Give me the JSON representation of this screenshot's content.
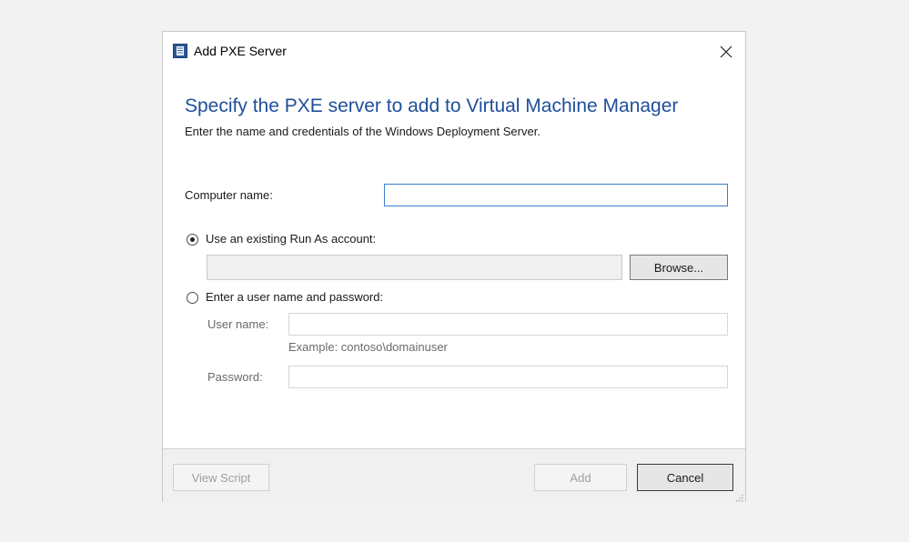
{
  "dialog": {
    "title": "Add PXE Server",
    "heading": "Specify the PXE server to add to Virtual Machine Manager",
    "subheading": "Enter the name and credentials of the Windows Deployment Server.",
    "computer_name": {
      "label": "Computer name:",
      "value": ""
    },
    "run_as": {
      "label": "Use an existing Run As account:",
      "selected": true,
      "value": "",
      "browse_label": "Browse..."
    },
    "user_pass": {
      "label": "Enter a user name and password:",
      "selected": false,
      "username_label": "User name:",
      "username_value": "",
      "example": "Example: contoso\\domainuser",
      "password_label": "Password:",
      "password_value": ""
    }
  },
  "footer": {
    "view_script_label": "View Script",
    "add_label": "Add",
    "cancel_label": "Cancel"
  },
  "icons": {
    "app": "server-icon",
    "close": "close-icon",
    "grip": "resize-grip-icon"
  },
  "colors": {
    "heading": "#1e4e9c",
    "focus_border": "#3c7fd1",
    "app_icon": "#2b5797"
  }
}
